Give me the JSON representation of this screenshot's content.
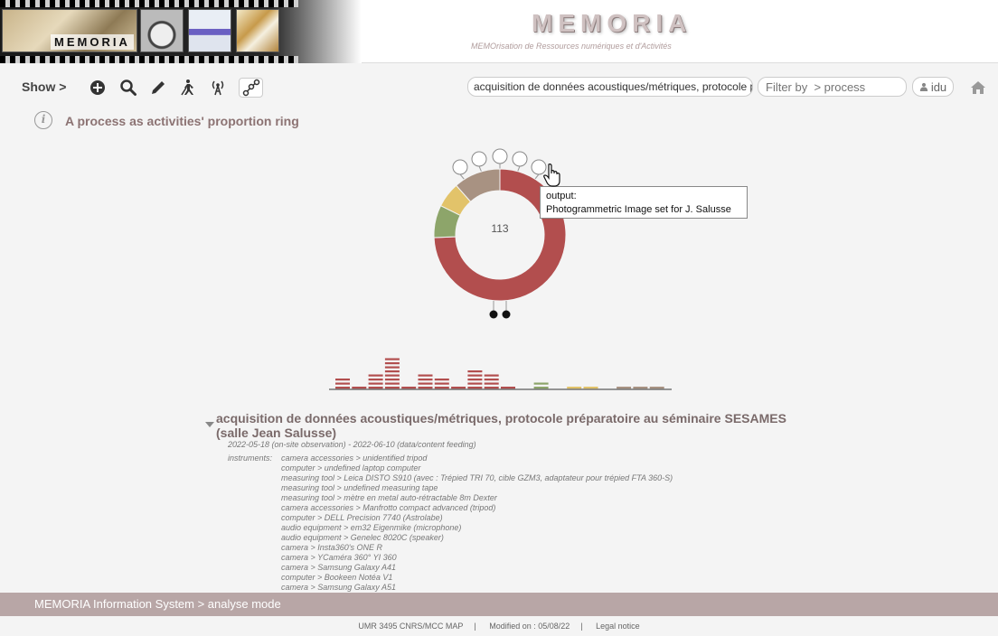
{
  "header": {
    "banner_logo": "MEMORIA",
    "site_title": "MEMORIA",
    "site_subtitle": "MEMOrisation de Ressources numériques et d'Activités"
  },
  "toolbar": {
    "show_label": "Show >",
    "process_value": "acquisition de données acoustiques/métriques, protocole prépa",
    "filter_placeholder": "Filter by  > process",
    "user_label": "idu"
  },
  "section": {
    "title": "A process as activities' proportion ring"
  },
  "colors": {
    "red": "#b24e4e",
    "green": "#8da56a",
    "yellow": "#e2c36a",
    "taupe": "#a89282"
  },
  "chart_data": {
    "type": "ring",
    "center_label": "113",
    "segments": [
      {
        "name": "red",
        "value": 84,
        "color": "#b24e4e"
      },
      {
        "name": "green",
        "value": 9,
        "color": "#8da56a"
      },
      {
        "name": "yellow",
        "value": 7,
        "color": "#e2c36a"
      },
      {
        "name": "taupe",
        "value": 13,
        "color": "#a89282"
      }
    ],
    "bars": [
      {
        "value": 3,
        "color": "#b24e4e"
      },
      {
        "value": 1,
        "color": "#b24e4e"
      },
      {
        "value": 4,
        "color": "#b24e4e"
      },
      {
        "value": 8,
        "color": "#b24e4e"
      },
      {
        "value": 1,
        "color": "#b24e4e"
      },
      {
        "value": 4,
        "color": "#b24e4e"
      },
      {
        "value": 3,
        "color": "#b24e4e"
      },
      {
        "value": 1,
        "color": "#b24e4e"
      },
      {
        "value": 5,
        "color": "#b24e4e"
      },
      {
        "value": 4,
        "color": "#b24e4e"
      },
      {
        "value": 1,
        "color": "#b24e4e"
      },
      {
        "value": 0,
        "color": "#b24e4e"
      },
      {
        "value": 2,
        "color": "#8da56a"
      },
      {
        "value": 0,
        "color": "#8da56a"
      },
      {
        "value": 1,
        "color": "#e2c36a"
      },
      {
        "value": 1,
        "color": "#e2c36a"
      },
      {
        "value": 0,
        "color": "#e2c36a"
      },
      {
        "value": 1,
        "color": "#a89282"
      },
      {
        "value": 1,
        "color": "#a89282"
      },
      {
        "value": 1,
        "color": "#a89282"
      }
    ]
  },
  "tooltip": {
    "line1": "output:",
    "line2": "Photogrammetric Image set for J. Salusse"
  },
  "process": {
    "title": "acquisition de données acoustiques/métriques, protocole préparatoire au séminaire SESAMES (salle Jean Salusse)",
    "dates": "2022-05-18 (on-site observation) - 2022-06-10 (data/content feeding)",
    "instruments_label": "instruments:",
    "instruments": [
      "camera accessories > unidentified tripod",
      "computer > undefined laptop computer",
      "measuring tool > Leica DISTO S910 (avec : Trépied TRI 70, cible GZM3, adaptateur pour trépied FTA 360-S)",
      "measuring tool > undefined measuring tape",
      "measuring tool > mètre en metal auto-rétractable 8m Dexter",
      "camera accessories > Manfrotto compact advanced (tripod)",
      "computer > DELL Precision 7740 (Astrolabe)",
      "audio equipment > em32 Eigenmike (microphone)",
      "audio equipment > Genelec 8020C (speaker)",
      "camera > Insta360's ONE R",
      "camera > YCaméra 360° YI 360",
      "camera > Samsung Galaxy A41",
      "computer > Bookeen Notéa V1",
      "camera > Samsung Galaxy A51"
    ]
  },
  "footer": {
    "status": "MEMORIA  Information System  >  analyse mode",
    "lab": "UMR 3495 CNRS/MCC MAP",
    "modified": "Modified on : 05/08/22",
    "legal": "Legal notice"
  }
}
